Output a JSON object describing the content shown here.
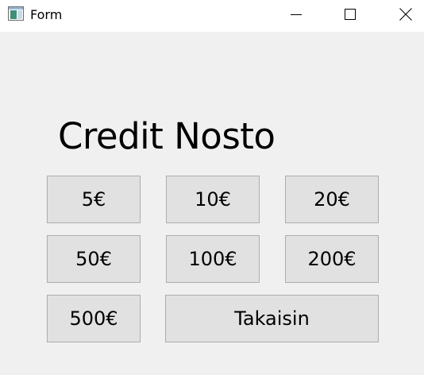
{
  "window": {
    "title": "Form",
    "controls": {
      "minimize_icon": "minimize-icon",
      "maximize_icon": "maximize-icon",
      "close_icon": "close-icon"
    }
  },
  "main": {
    "heading": "Credit Nosto",
    "buttons": {
      "b5": "5€",
      "b10": "10€",
      "b20": "20€",
      "b50": "50€",
      "b100": "100€",
      "b200": "200€",
      "b500": "500€",
      "back": "Takaisin"
    }
  },
  "colors": {
    "window_bg": "#f0f0f0",
    "titlebar_bg": "#ffffff",
    "button_bg": "#e1e1e1",
    "button_border": "#adadad"
  }
}
